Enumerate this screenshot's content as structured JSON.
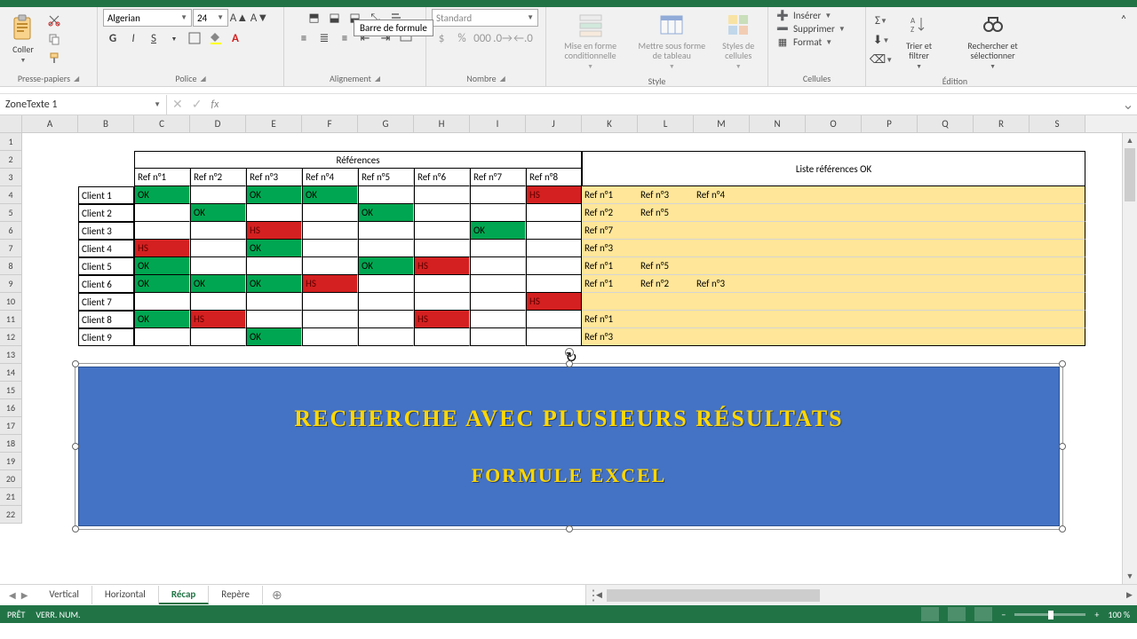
{
  "ribbon": {
    "clipboard": {
      "paste": "Coller",
      "label": "Presse-papiers"
    },
    "font": {
      "name": "Algerian",
      "size": "24",
      "bold": "G",
      "italic": "I",
      "underline": "S",
      "label": "Police"
    },
    "alignment": {
      "label": "Alignement"
    },
    "number": {
      "format": "Standard",
      "label": "Nombre"
    },
    "styles": {
      "conditional": "Mise en forme conditionnelle",
      "table": "Mettre sous forme de tableau",
      "cellstyles": "Styles de cellules",
      "label": "Style"
    },
    "cells": {
      "insert": "Insérer",
      "delete": "Supprimer",
      "format": "Format",
      "label": "Cellules"
    },
    "editing": {
      "sort": "Trier et filtrer",
      "find": "Rechercher et sélectionner",
      "label": "Édition"
    }
  },
  "formula_bar": {
    "name_box": "ZoneTexte 1",
    "tooltip": "Barre de formule"
  },
  "columns": [
    "A",
    "B",
    "C",
    "D",
    "E",
    "F",
    "G",
    "H",
    "I",
    "J",
    "K",
    "L",
    "M",
    "N",
    "O",
    "P",
    "Q",
    "R",
    "S"
  ],
  "row_count": 22,
  "headers": {
    "references": "Références",
    "ref_cols": [
      "Ref n°1",
      "Ref n°2",
      "Ref n°3",
      "Ref n°4",
      "Ref n°5",
      "Ref n°6",
      "Ref n°7",
      "Ref n°8"
    ],
    "liste": "Liste références OK"
  },
  "clients": [
    "Client 1",
    "Client 2",
    "Client 3",
    "Client 4",
    "Client 5",
    "Client 6",
    "Client 7",
    "Client 8",
    "Client 9"
  ],
  "matrix": [
    [
      "OK",
      "",
      "OK",
      "OK",
      "",
      "",
      "",
      "HS"
    ],
    [
      "",
      "OK",
      "",
      "",
      "OK",
      "",
      "",
      ""
    ],
    [
      "",
      "",
      "HS",
      "",
      "",
      "",
      "OK",
      ""
    ],
    [
      "HS",
      "",
      "OK",
      "",
      "",
      "",
      "",
      ""
    ],
    [
      "OK",
      "",
      "",
      "",
      "OK",
      "HS",
      "",
      ""
    ],
    [
      "OK",
      "OK",
      "OK",
      "HS",
      "",
      "",
      "",
      ""
    ],
    [
      "",
      "",
      "",
      "",
      "",
      "",
      "",
      "HS"
    ],
    [
      "OK",
      "HS",
      "",
      "",
      "",
      "HS",
      "",
      ""
    ],
    [
      "",
      "",
      "OK",
      "",
      "",
      "",
      "",
      ""
    ]
  ],
  "liste_rows": [
    [
      "Ref n°1",
      "Ref n°3",
      "Ref n°4"
    ],
    [
      "Ref n°2",
      "Ref n°5",
      ""
    ],
    [
      "Ref n°7",
      "",
      ""
    ],
    [
      "Ref n°3",
      "",
      ""
    ],
    [
      "Ref n°1",
      "Ref n°5",
      ""
    ],
    [
      "Ref n°1",
      "Ref n°2",
      "Ref n°3"
    ],
    [
      "",
      "",
      ""
    ],
    [
      "Ref n°1",
      "",
      ""
    ],
    [
      "Ref n°3",
      "",
      ""
    ]
  ],
  "textbox": {
    "line1": "RECHERCHE AVEC PLUSIEURS RÉSULTATS",
    "line2": "FORMULE EXCEL"
  },
  "tabs": [
    "Vertical",
    "Horizontal",
    "Récap",
    "Repère"
  ],
  "active_tab": 2,
  "status": {
    "ready": "PRÊT",
    "lock": "VERR. NUM.",
    "zoom": "100 %"
  }
}
